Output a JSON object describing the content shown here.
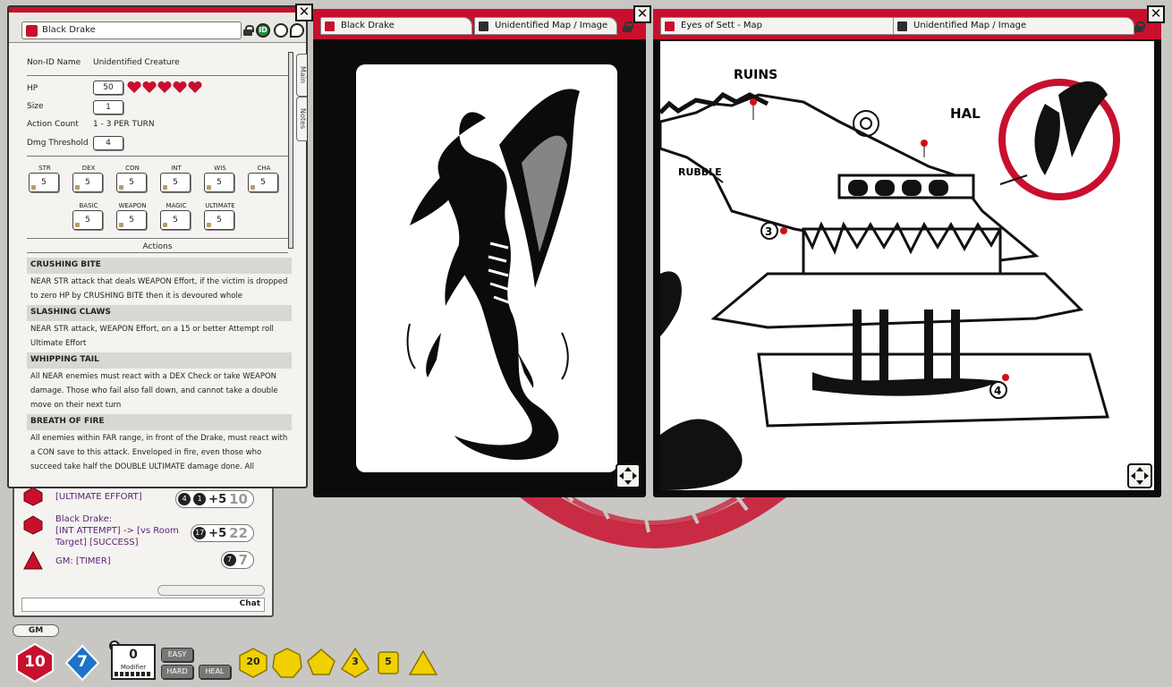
{
  "colors": {
    "accent": "#c8102e",
    "panel": "#f4f3ef",
    "ink": "#0b0b0b",
    "chat_text": "#5a1f7a",
    "die_yellow": "#f0d000",
    "die_blue": "#1e73c8"
  },
  "chat": {
    "lines": [
      {
        "text": "[ULTIMATE EFFORT]",
        "roll": {
          "dice": [
            "4",
            "1"
          ],
          "modifier": "+5",
          "total": "10"
        }
      },
      {
        "text": "Black Drake:\n[INT ATTEMPT] -> [vs Room Target] [SUCCESS]",
        "roll": {
          "dice": [
            "17"
          ],
          "modifier": "+5",
          "total": "22"
        }
      },
      {
        "text": "GM:  [TIMER]",
        "roll": {
          "dice": [
            "7"
          ],
          "modifier": "",
          "total": "7"
        }
      }
    ],
    "send_label": "Chat"
  },
  "npc": {
    "name": "Black Drake",
    "side_tabs": [
      "Main",
      "Notes"
    ],
    "id_badge": "ID",
    "fields": {
      "nonid_label": "Non-ID Name",
      "nonid_value": "Unidentified Creature",
      "hp_label": "HP",
      "hp_value": "50",
      "hp_hearts": 5,
      "size_label": "Size",
      "size_value": "1",
      "action_count_label": "Action Count",
      "action_count_value": "1 - 3 PER TURN",
      "dmg_label": "Dmg Threshold",
      "dmg_value": "4"
    },
    "stats": [
      {
        "label": "STR",
        "value": "5"
      },
      {
        "label": "DEX",
        "value": "5"
      },
      {
        "label": "CON",
        "value": "5"
      },
      {
        "label": "INT",
        "value": "5"
      },
      {
        "label": "WIS",
        "value": "5"
      },
      {
        "label": "CHA",
        "value": "5"
      }
    ],
    "efforts": [
      {
        "label": "BASIC",
        "value": "5"
      },
      {
        "label": "WEAPON",
        "value": "5"
      },
      {
        "label": "MAGIC",
        "value": "5"
      },
      {
        "label": "ULTIMATE",
        "value": "5"
      }
    ],
    "actions_title": "Actions",
    "actions": [
      {
        "name": "CRUSHING BITE",
        "desc": "NEAR STR attack that deals WEAPON Effort, if the victim is dropped to zero HP by CRUSHING BITE then it is devoured whole"
      },
      {
        "name": "SLASHING CLAWS",
        "desc": "NEAR STR attack, WEAPON Effort, on a 15 or better Attempt roll Ultimate Effort"
      },
      {
        "name": "WHIPPING TAIL",
        "desc": "All NEAR enemies must react with a DEX Check or take WEAPON damage. Those who fail also fall down, and cannot take a double move on their next turn"
      },
      {
        "name": "BREATH OF FIRE",
        "desc": "All enemies within FAR range, in front of the Drake, must react with a CON save to this attack. Enveloped in fire, even those who succeed take half the DOUBLE ULTIMATE damage done. All"
      }
    ]
  },
  "drake_window": {
    "tab1": "Black Drake",
    "tab2": "Unidentified Map / Image"
  },
  "map_window": {
    "tab1": "Eyes of Sett - Map",
    "tab2": "Unidentified Map / Image",
    "labels": {
      "ruins": "RUINS",
      "hal": "HAL",
      "rubble": "RUBBLE",
      "pin3": "3",
      "pin4": "4"
    }
  },
  "bottom": {
    "gm_label": "GM",
    "d20_value": "10",
    "d4_value": "7",
    "modifier_value": "0",
    "modifier_label": "Modifier",
    "easy": "EASY",
    "hard": "HARD",
    "heal": "HEAL",
    "yellow_dice": [
      "20",
      "",
      "",
      "3",
      "5",
      ""
    ]
  }
}
